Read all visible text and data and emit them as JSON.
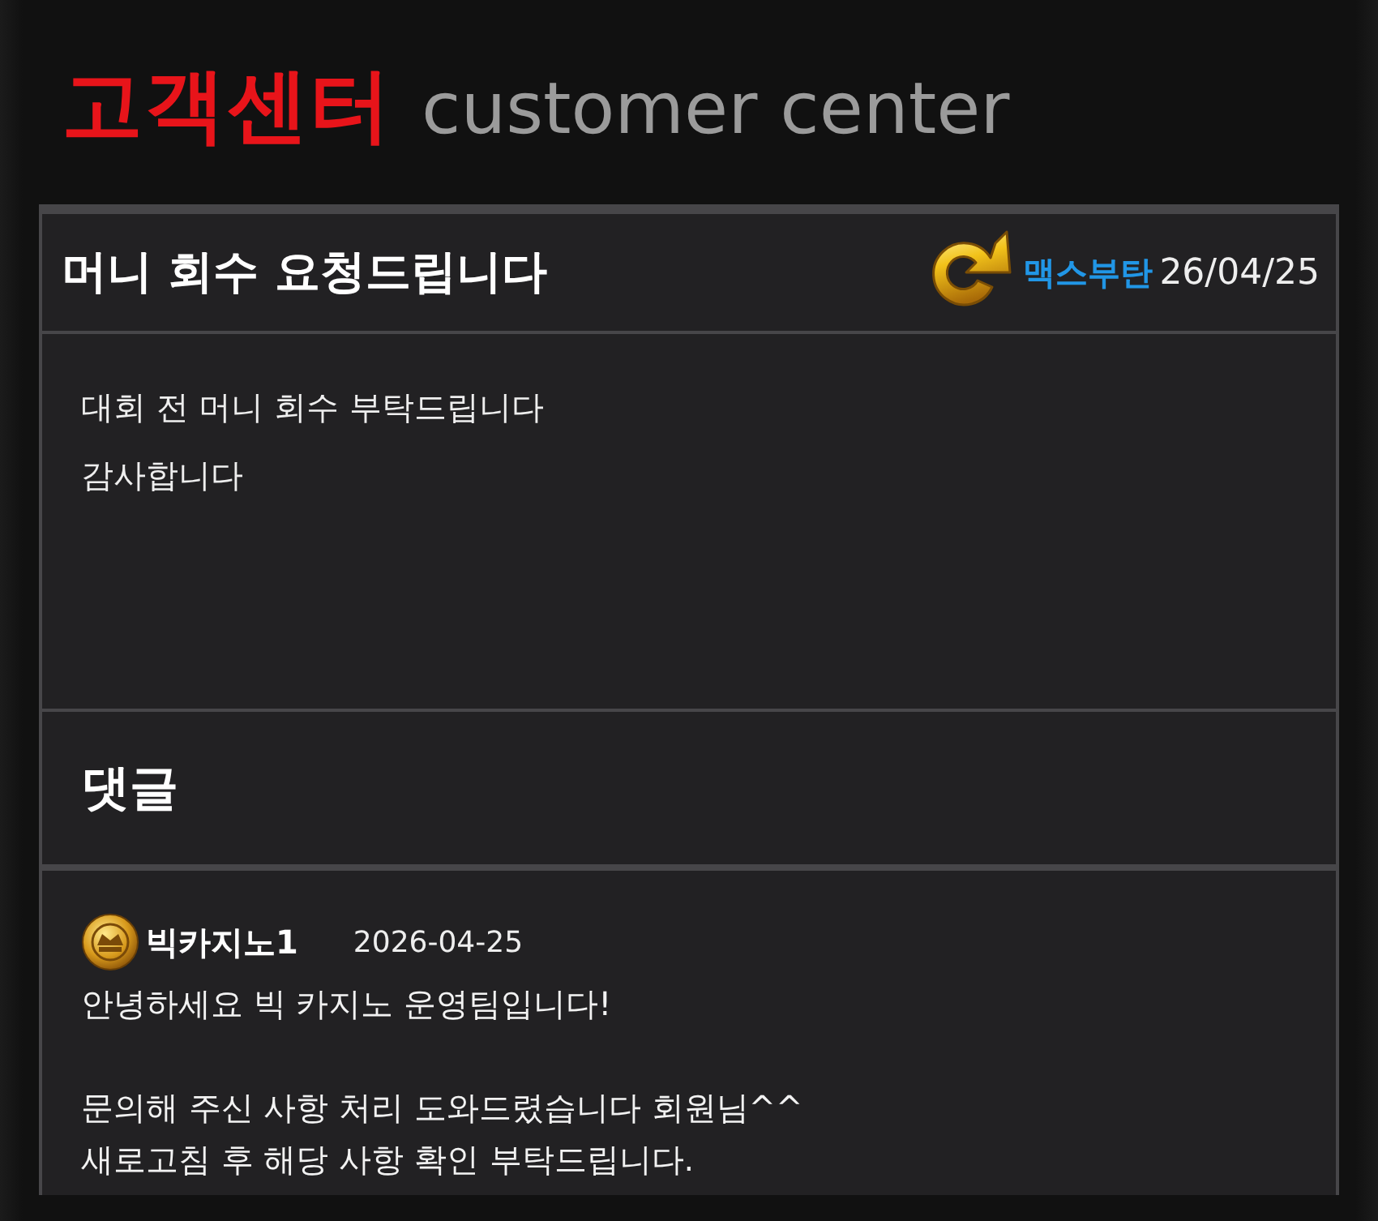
{
  "page_title": {
    "korean": "고객센터",
    "english": "customer center"
  },
  "post": {
    "title": "머니 회수 요청드립니다",
    "author": "맥스부탄",
    "date": "26/04/25",
    "body_lines": [
      "대회 전 머니 회수 부탁드립니다",
      "감사합니다"
    ]
  },
  "comments_heading": "댓글",
  "comments": [
    {
      "author": "빅카지노1",
      "date": "2026-04-25",
      "paragraphs": [
        [
          "안녕하세요 빅 카지노 운영팀입니다!"
        ],
        [
          "문의해 주신 사항 처리 도와드렸습니다 회원님^^",
          "새로고침 후 해당 사항 확인 부탁드립니다."
        ]
      ]
    }
  ]
}
